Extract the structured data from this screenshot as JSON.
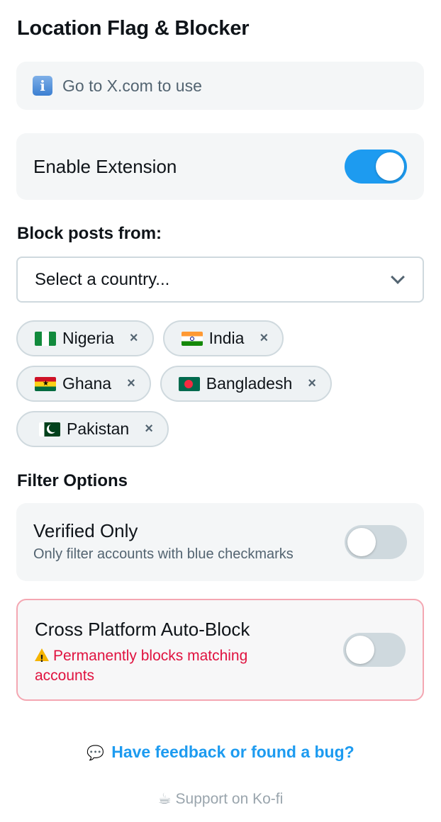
{
  "title": "Location Flag & Blocker",
  "info": {
    "icon": "info-icon",
    "icon_glyph": "i",
    "text": "Go to X.com to use"
  },
  "enable": {
    "label": "Enable Extension",
    "enabled": true
  },
  "block_section": {
    "label": "Block posts from:"
  },
  "country_select": {
    "placeholder": "Select a country...",
    "icon": "chevron-down-icon"
  },
  "blocked_countries": [
    {
      "name": "Nigeria",
      "flag": "nigeria-flag-icon",
      "remove": "×"
    },
    {
      "name": "India",
      "flag": "india-flag-icon",
      "remove": "×"
    },
    {
      "name": "Ghana",
      "flag": "ghana-flag-icon",
      "remove": "×"
    },
    {
      "name": "Bangladesh",
      "flag": "bangladesh-flag-icon",
      "remove": "×"
    },
    {
      "name": "Pakistan",
      "flag": "pakistan-flag-icon",
      "remove": "×"
    }
  ],
  "filter_section": {
    "label": "Filter Options"
  },
  "verified_only": {
    "title": "Verified Only",
    "description": "Only filter accounts with blue checkmarks",
    "enabled": false
  },
  "auto_block": {
    "title": "Cross Platform Auto-Block",
    "warning": "Permanently blocks matching accounts",
    "enabled": false
  },
  "feedback": {
    "icon": "speech-bubble-icon",
    "glyph": "💬",
    "text": "Have feedback or found a bug?"
  },
  "support": {
    "icon": "coffee-icon",
    "glyph": "☕",
    "text": "Support on Ko-fi"
  },
  "colors": {
    "accent": "#1d9bf0",
    "danger": "#e0123f",
    "panel": "#f4f6f7"
  }
}
